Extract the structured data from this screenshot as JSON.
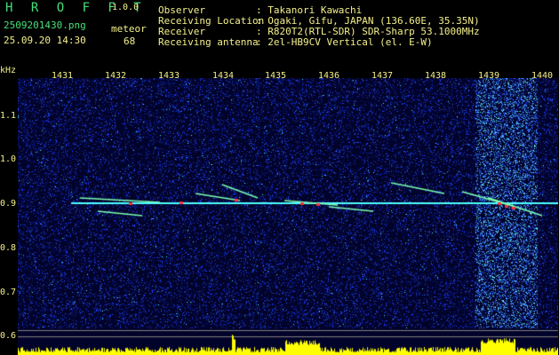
{
  "app": {
    "logo": "H R O F F T",
    "version": "1.0.0"
  },
  "file": {
    "name": "2509201430.png",
    "datetime": "25.09.20 14:30"
  },
  "meteor": {
    "label": "meteor",
    "count": "68"
  },
  "info": [
    {
      "label": "Observer",
      "value": ": Takanori Kawachi"
    },
    {
      "label": "Receiving Location",
      "value": ": Ogaki, Gifu, JAPAN (136.60E, 35.35N)"
    },
    {
      "label": "Receiver",
      "value": ": R820T2(RTL-SDR) SDR-Sharp 53.1000MHz"
    },
    {
      "label": "Receiving antenna",
      "value": ": 2el-HB9CV Vertical (el. E-W)"
    }
  ],
  "axis": {
    "y_unit": "kHz",
    "y_ticks": [
      "1.1",
      "1.0",
      "0.9",
      "0.8",
      "0.7",
      "0.6"
    ],
    "x_ticks": [
      "1431",
      "1432",
      "1433",
      "1434",
      "1435",
      "1436",
      "1437",
      "1438",
      "1439",
      "1440"
    ]
  },
  "colors": {
    "background": "#02032a",
    "noise": "#1a3cff",
    "echo": "#ff3040",
    "carrier": "#4cffff",
    "histogram": "#ffff00",
    "text_green": "#46e07a",
    "text_yellow": "#f4f08a"
  }
}
